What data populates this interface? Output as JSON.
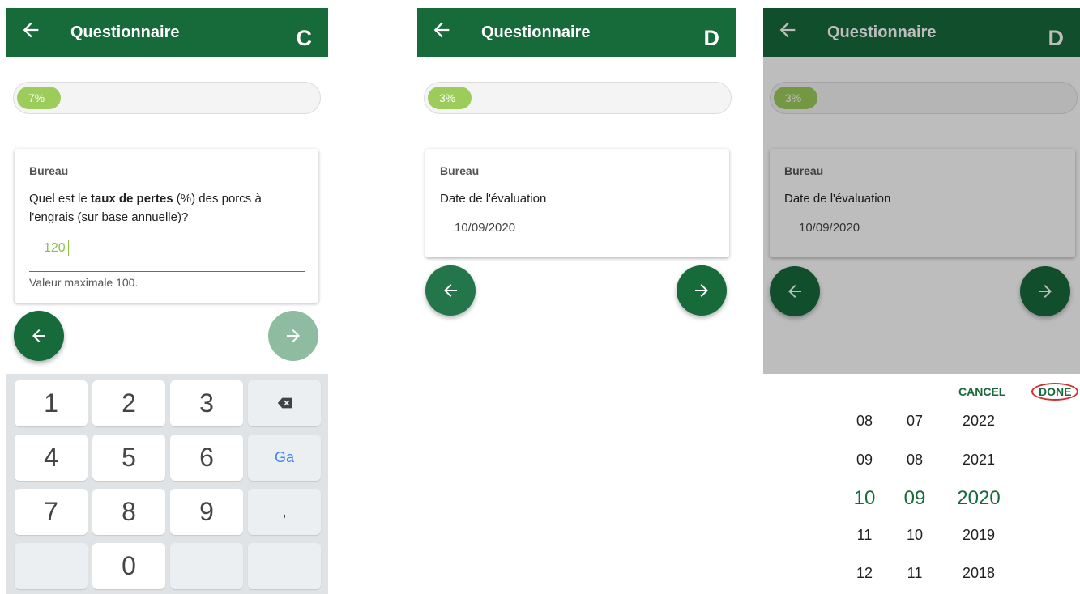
{
  "panels": {
    "c": {
      "title": "Questionnaire",
      "letter": "C",
      "progress_label": "7%",
      "progress_fraction": 0.07,
      "section": "Bureau",
      "question_before": "Quel est le ",
      "question_bold": "taux de pertes",
      "question_after": " (%) des porcs à l'engrais (sur base annuelle)?",
      "input_value": "120",
      "error_message": "Valeur maximale 100.",
      "keys": [
        "1",
        "2",
        "3",
        "4",
        "5",
        "6",
        "Ga",
        "7",
        "8",
        "9",
        ",",
        "0"
      ]
    },
    "d1": {
      "title": "Questionnaire",
      "letter": "D",
      "progress_label": "3%",
      "progress_fraction": 0.03,
      "section": "Bureau",
      "question": "Date de l'évaluation",
      "date_value": "10/09/2020"
    },
    "d2": {
      "title": "Questionnaire",
      "letter": "D",
      "progress_label": "3%",
      "progress_fraction": 0.03,
      "section": "Bureau",
      "question": "Date de l'évaluation",
      "date_value": "10/09/2020",
      "cancel_label": "CANCEL",
      "done_label": "DONE",
      "day_wheel": [
        "08",
        "09",
        "10",
        "11",
        "12"
      ],
      "month_wheel": [
        "07",
        "08",
        "09",
        "10",
        "11"
      ],
      "year_wheel": [
        "2022",
        "2021",
        "2020",
        "2019",
        "2018"
      ],
      "selected": {
        "day": "10",
        "month": "09",
        "year": "2020"
      }
    }
  },
  "colors": {
    "appbar": "#176a3a",
    "progress_fill": "#9ccc5a",
    "input_accent": "#8bc34a",
    "error_line": "#e53935",
    "fab_dark": "#176a3a",
    "fab_disabled": "#8fbca0",
    "done_circle": "#d32f2f"
  },
  "icons": {
    "back": "arrow-left-icon",
    "next": "arrow-right-icon",
    "backspace": "backspace-icon"
  }
}
